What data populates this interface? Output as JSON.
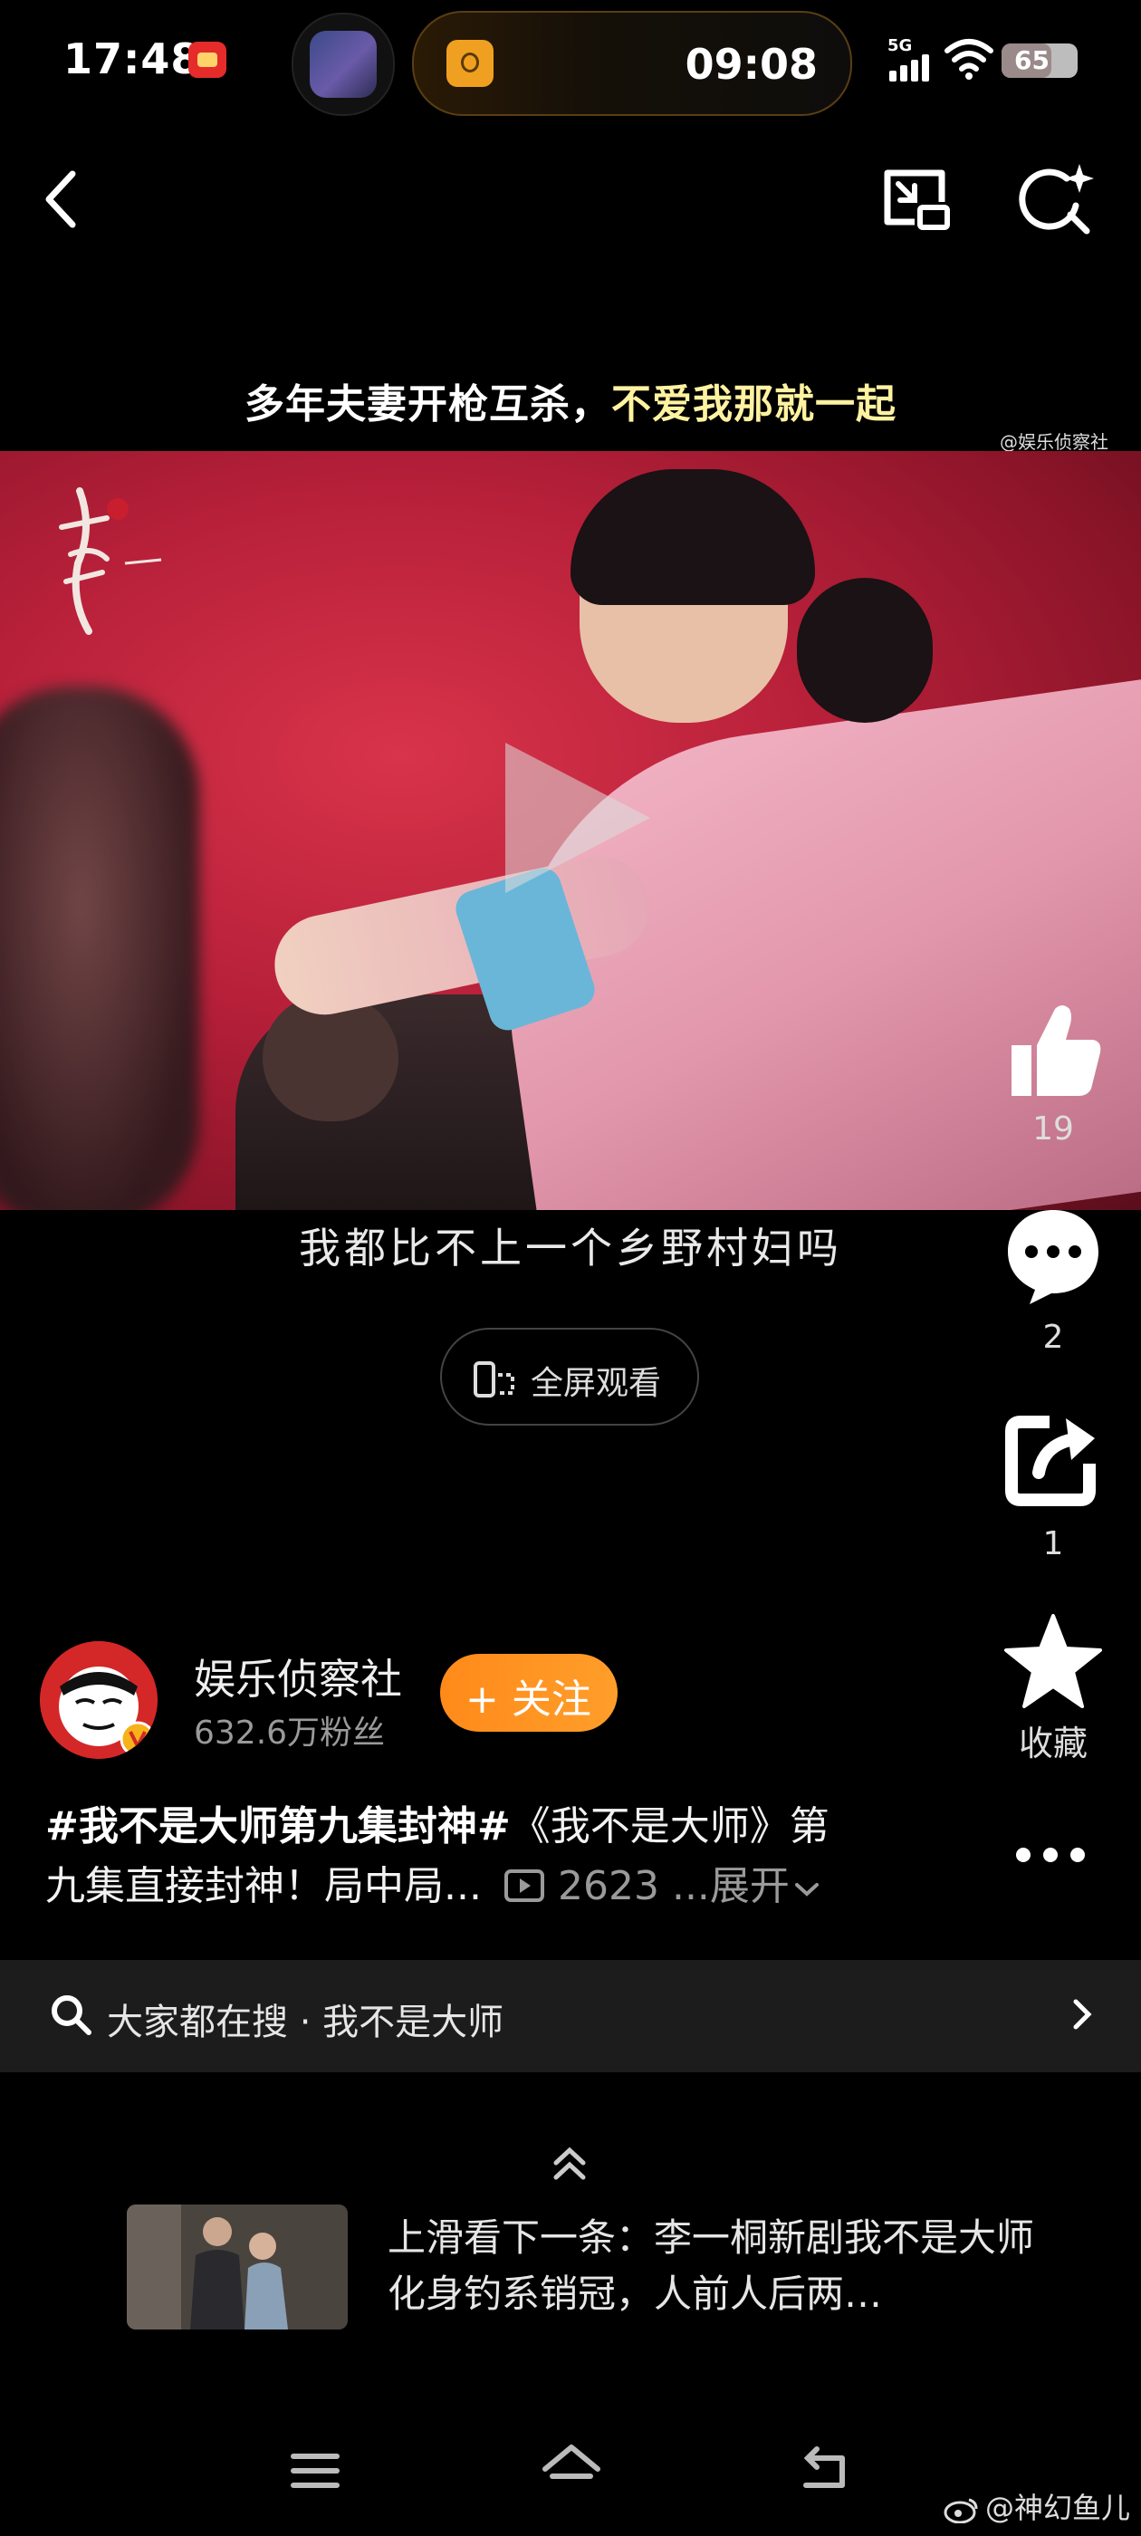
{
  "status_bar": {
    "time": "17:48",
    "timer": "09:08",
    "network": "5G",
    "battery": "65",
    "battery_level": 0.65
  },
  "video": {
    "title_main": "多年夫妻开枪互杀，",
    "title_highlight": "不爱我那就一起",
    "watermark": "@娱乐侦察社",
    "caption": "我都比不上一个乡野村妇吗",
    "fullscreen_label": "全屏观看"
  },
  "actions": {
    "like_count": "19",
    "comment_count": "2",
    "share_count": "1",
    "favorite_label": "收藏"
  },
  "author": {
    "name": "娱乐侦察社",
    "fans": "632.6万粉丝",
    "follow_label": "+ 关注"
  },
  "description": {
    "tag": "#我不是大师第九集封神#",
    "text_line1": "《我不是大师》第",
    "text_line2": "九集直接封神！局中局...",
    "views": "2623",
    "expand_label": "...展开"
  },
  "search": {
    "text": "大家都在搜 · 我不是大师"
  },
  "next": {
    "text": "上滑看下一条：李一桐新剧我不是大师化身钓系销冠，人前人后两…"
  },
  "footer": {
    "watermark": "@神幻鱼儿"
  },
  "colors": {
    "follow_button": "#ff8a1a",
    "background": "#000000",
    "title_highlight": "#fff2a0"
  }
}
